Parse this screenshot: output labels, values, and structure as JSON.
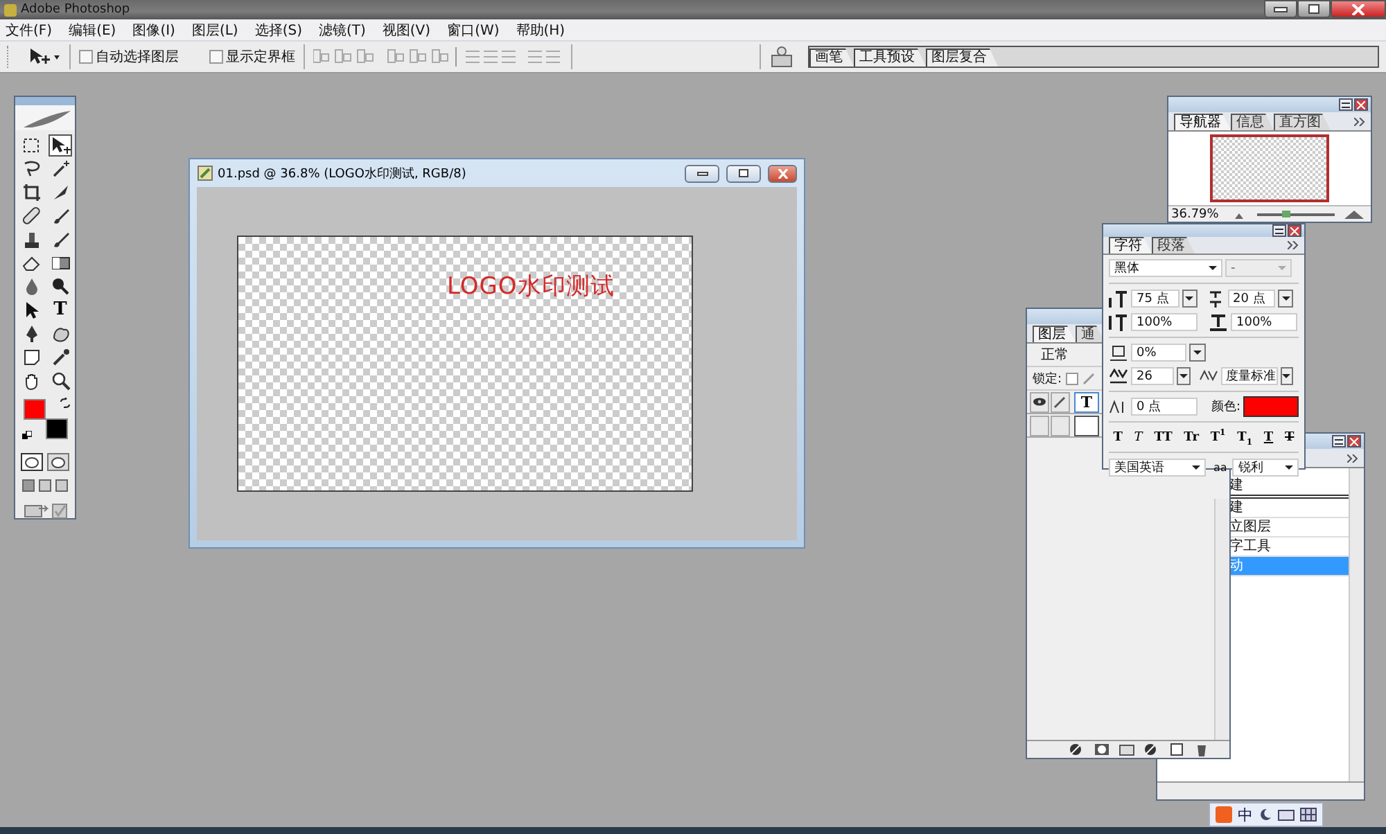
{
  "app_title": "Adobe Photoshop",
  "menu": [
    "文件(F)",
    "编辑(E)",
    "图像(I)",
    "图层(L)",
    "选择(S)",
    "滤镜(T)",
    "视图(V)",
    "窗口(W)",
    "帮助(H)"
  ],
  "options_bar": {
    "checkboxes": [
      {
        "label": "自动选择图层",
        "checked": false
      },
      {
        "label": "显示定界框",
        "checked": false
      }
    ],
    "palette_well_tabs": [
      "画笔",
      "工具预设",
      "图层复合"
    ]
  },
  "toolbox": {
    "tools": [
      {
        "kind": "marquee",
        "selected": false
      },
      {
        "kind": "move",
        "selected": true
      },
      {
        "kind": "lasso",
        "selected": false
      },
      {
        "kind": "wand",
        "selected": false
      },
      {
        "kind": "crop",
        "selected": false
      },
      {
        "kind": "slice",
        "selected": false
      },
      {
        "kind": "bandage",
        "selected": false
      },
      {
        "kind": "brush",
        "selected": false
      },
      {
        "kind": "stamp",
        "selected": false
      },
      {
        "kind": "brush",
        "selected": false
      },
      {
        "kind": "eraser",
        "selected": false
      },
      {
        "kind": "gradient",
        "selected": false
      },
      {
        "kind": "drop",
        "selected": false
      },
      {
        "kind": "dodge",
        "selected": false
      },
      {
        "kind": "arrow",
        "selected": false
      },
      {
        "kind": "type",
        "label": "T",
        "selected": false
      },
      {
        "kind": "pen",
        "selected": false
      },
      {
        "kind": "shape",
        "selected": false
      },
      {
        "kind": "note",
        "selected": false
      },
      {
        "kind": "eyedropper",
        "selected": false
      },
      {
        "kind": "hand",
        "selected": false
      },
      {
        "kind": "zoom",
        "selected": false
      }
    ],
    "colors": [
      {
        "kind": "foreground",
        "color": "#ff0000"
      },
      {
        "kind": "background",
        "color": "#000000"
      }
    ]
  },
  "document": {
    "title": "01.psd @ 36.8% (LOGO水印测试, RGB/8)",
    "canvas_text": "LOGO水印测试"
  },
  "navigator": {
    "tabs": [
      {
        "label": "导航器",
        "selected": true
      },
      {
        "label": "信息",
        "selected": false
      },
      {
        "label": "直方图",
        "selected": false
      }
    ],
    "zoom": "36.79%",
    "zoom_slider": {
      "level": 0.35
    }
  },
  "character": {
    "tabs": [
      {
        "label": "字符",
        "selected": true
      },
      {
        "label": "段落",
        "selected": false
      }
    ],
    "font": "黑体",
    "font_style": "-",
    "size": "75 点",
    "leading": "20 点",
    "vertical_scale": "100%",
    "horizontal_scale": "100%",
    "tsume": "0%",
    "tracking": "26",
    "kerning": "度量标准",
    "baseline": "0 点",
    "color_label": "颜色:",
    "color": "#ff0000",
    "style_buttons": [
      {
        "kind": "bold",
        "label": "T"
      },
      {
        "kind": "italic",
        "label": "T"
      },
      {
        "kind": "caps",
        "label": "TT"
      },
      {
        "kind": "smallcaps",
        "label": "Tr"
      },
      {
        "kind": "super",
        "label": "T$^{1}$"
      },
      {
        "kind": "sub",
        "label": "T$_{1}$"
      },
      {
        "kind": "underline",
        "label": "T"
      },
      {
        "kind": "strike",
        "label": "T"
      }
    ],
    "language": "美国英语",
    "antialias_label": "aa",
    "antialias": "锐利"
  },
  "layers": {
    "tabs": [
      {
        "label": "图层",
        "selected": true
      },
      {
        "label": "通",
        "selected": false
      }
    ],
    "blend_mode": "正常",
    "lock_label": "锁定:",
    "lock_transparency": {
      "checked": false
    },
    "rows": [
      {
        "kind": "text",
        "label": "T",
        "visible": true
      },
      {
        "kind": "blank",
        "visible": false
      }
    ]
  },
  "history": {
    "items": [
      {
        "label": "建",
        "kind": "snapshot",
        "selected": false
      },
      {
        "label": "建",
        "kind": "step",
        "selected": false
      },
      {
        "label": "立图层",
        "kind": "step",
        "selected": false
      },
      {
        "label": "字工具",
        "kind": "step",
        "selected": false
      },
      {
        "label": "动",
        "kind": "step",
        "selected": true
      }
    ]
  },
  "tray": {
    "ime": "中"
  }
}
